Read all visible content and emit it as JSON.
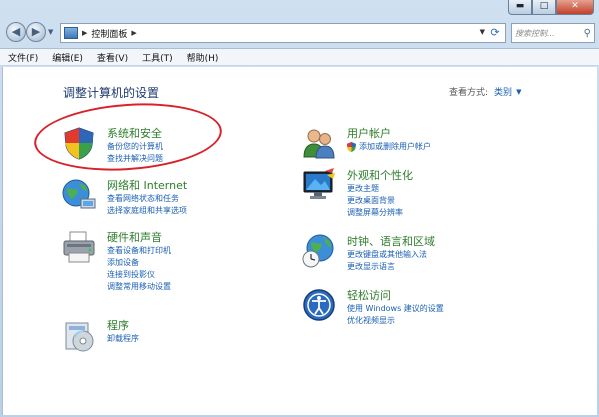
{
  "window": {
    "minimize": "▬",
    "maximize": "□",
    "close": "✕"
  },
  "address": {
    "path": "控制面板",
    "search_placeholder": "搜索控制..."
  },
  "menu": [
    "文件(F)",
    "编辑(E)",
    "查看(V)",
    "工具(T)",
    "帮助(H)"
  ],
  "main": {
    "title": "调整计算机的设置",
    "view_by_label": "查看方式:",
    "view_by_value": "类别"
  },
  "categories_left": [
    {
      "title": "系统和安全",
      "icon": "shield-icon",
      "links": [
        "备份您的计算机",
        "查找并解决问题"
      ]
    },
    {
      "title": "网络和 Internet",
      "icon": "network-globe-icon",
      "links": [
        "查看网络状态和任务",
        "选择家庭组和共享选项"
      ]
    },
    {
      "title": "硬件和声音",
      "icon": "printer-icon",
      "links": [
        "查看设备和打印机",
        "添加设备",
        "连接到投影仪",
        "调整常用移动设置"
      ]
    },
    {
      "title": "程序",
      "icon": "programs-icon",
      "links": [
        "卸载程序"
      ]
    }
  ],
  "categories_right": [
    {
      "title": "用户帐户",
      "icon": "users-icon",
      "links": [
        "添加或删除用户帐户"
      ]
    },
    {
      "title": "外观和个性化",
      "icon": "display-icon",
      "links": [
        "更改主题",
        "更改桌面背景",
        "调整屏幕分辨率"
      ]
    },
    {
      "title": "时钟、语言和区域",
      "icon": "clock-globe-icon",
      "links": [
        "更改键盘或其他输入法",
        "更改显示语言"
      ]
    },
    {
      "title": "轻松访问",
      "icon": "ease-of-access-icon",
      "links": [
        "使用 Windows 建议的设置",
        "优化视频显示"
      ]
    }
  ],
  "colors": {
    "category_title": "#2e7d2c",
    "link": "#1a5fb4",
    "annotation_oval": "#d8222a"
  }
}
